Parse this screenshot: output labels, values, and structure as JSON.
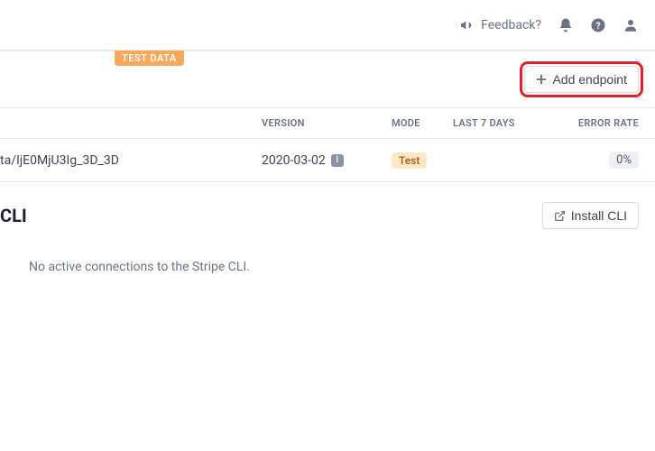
{
  "topbar": {
    "feedback_label": "Feedback?"
  },
  "banner": {
    "test_data_label": "TEST DATA"
  },
  "actions": {
    "add_endpoint_label": "Add endpoint",
    "install_cli_label": "Install CLI"
  },
  "table": {
    "headers": {
      "version": "VERSION",
      "mode": "MODE",
      "last7": "LAST 7 DAYS",
      "error_rate": "ERROR RATE"
    },
    "row": {
      "url": "ta/IjE0MjU3Ig_3D_3D",
      "version": "2020-03-02",
      "mode": "Test",
      "error_rate": "0%"
    }
  },
  "cli": {
    "title": "CLI",
    "no_connections": "No active connections to the Stripe CLI."
  },
  "icons": {
    "info_char": "i"
  }
}
